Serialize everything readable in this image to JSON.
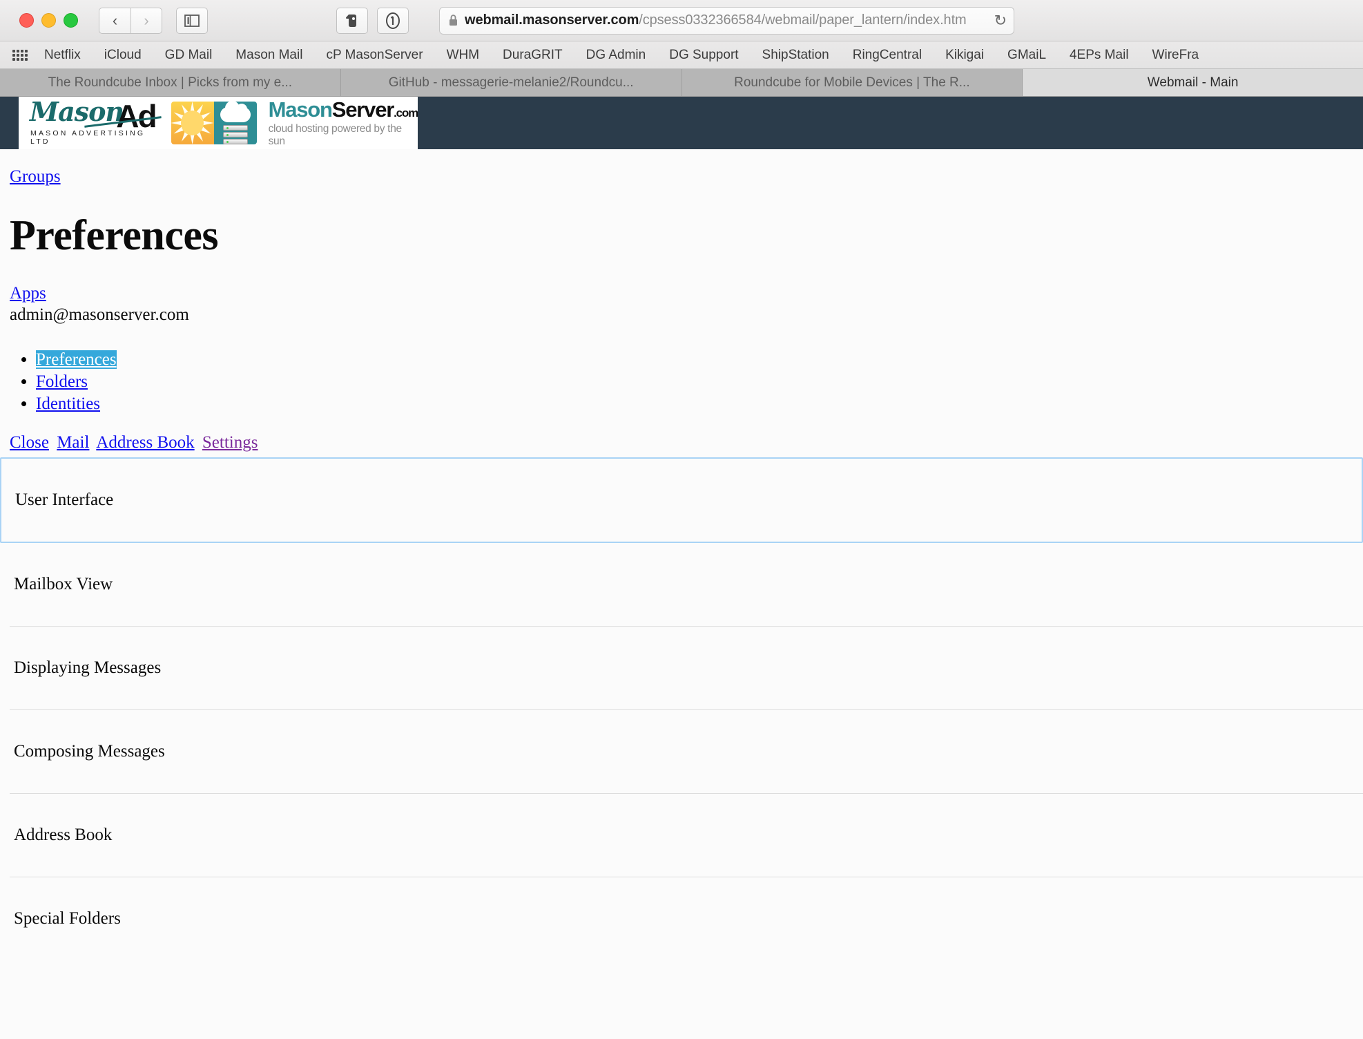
{
  "browser": {
    "window_controls": [
      "close",
      "minimize",
      "maximize"
    ],
    "back_icon": "‹",
    "forward_icon": "›",
    "sidebar_icon": "sidebar-icon",
    "extension_icons": [
      "evernote-icon",
      "1password-icon"
    ],
    "url": {
      "lock_icon": "lock-icon",
      "host": "webmail.masonserver.com",
      "path": "/cpsess0332366584/webmail/paper_lantern/index.htm",
      "reload_icon": "↻"
    },
    "bookmarks": [
      "Netflix",
      "iCloud",
      "GD Mail",
      "Mason Mail",
      "cP MasonServer",
      "WHM",
      "DuraGRIT",
      "DG Admin",
      "DG Support",
      "ShipStation",
      "RingCentral",
      "Kikigai",
      "GMaiL",
      "4EPs Mail",
      "WireFra"
    ],
    "tabs": [
      {
        "title": "The Roundcube Inbox | Picks from my e...",
        "active": false
      },
      {
        "title": "GitHub - messagerie-melanie2/Roundcu...",
        "active": false
      },
      {
        "title": "Roundcube for Mobile Devices | The R...",
        "active": false
      },
      {
        "title": "Webmail - Main",
        "active": true
      }
    ]
  },
  "ad_banner": {
    "background_color": "#2b3c4b",
    "masonad": {
      "script_text": "Mason",
      "ad_text": "Ad",
      "subtitle": "MASON ADVERTISING LTD"
    },
    "masonserver": {
      "brand_first": "Mason",
      "brand_second": "Server",
      "brand_tld": ".com",
      "tagline": "cloud hosting powered by the sun",
      "brand_color": "#2e8e95"
    }
  },
  "page": {
    "groups_link": "Groups",
    "title": "Preferences",
    "apps_link": "Apps",
    "account_email": "admin@masonserver.com",
    "settings_tabs": [
      {
        "label": "Preferences",
        "selected": true
      },
      {
        "label": "Folders",
        "selected": false
      },
      {
        "label": "Identities",
        "selected": false
      }
    ],
    "toolbar_links": [
      {
        "label": "Close",
        "visited": false
      },
      {
        "label": "Mail",
        "visited": false
      },
      {
        "label": "Address Book",
        "visited": false
      },
      {
        "label": "Settings",
        "visited": true
      }
    ],
    "sections": [
      {
        "label": "User Interface",
        "focused": true
      },
      {
        "label": "Mailbox View",
        "focused": false
      },
      {
        "label": "Displaying Messages",
        "focused": false
      },
      {
        "label": "Composing Messages",
        "focused": false
      },
      {
        "label": "Address Book",
        "focused": false
      },
      {
        "label": "Special Folders",
        "focused": false
      }
    ],
    "selection_color": "#35a8db",
    "focus_border_color": "#a9d3f5"
  }
}
